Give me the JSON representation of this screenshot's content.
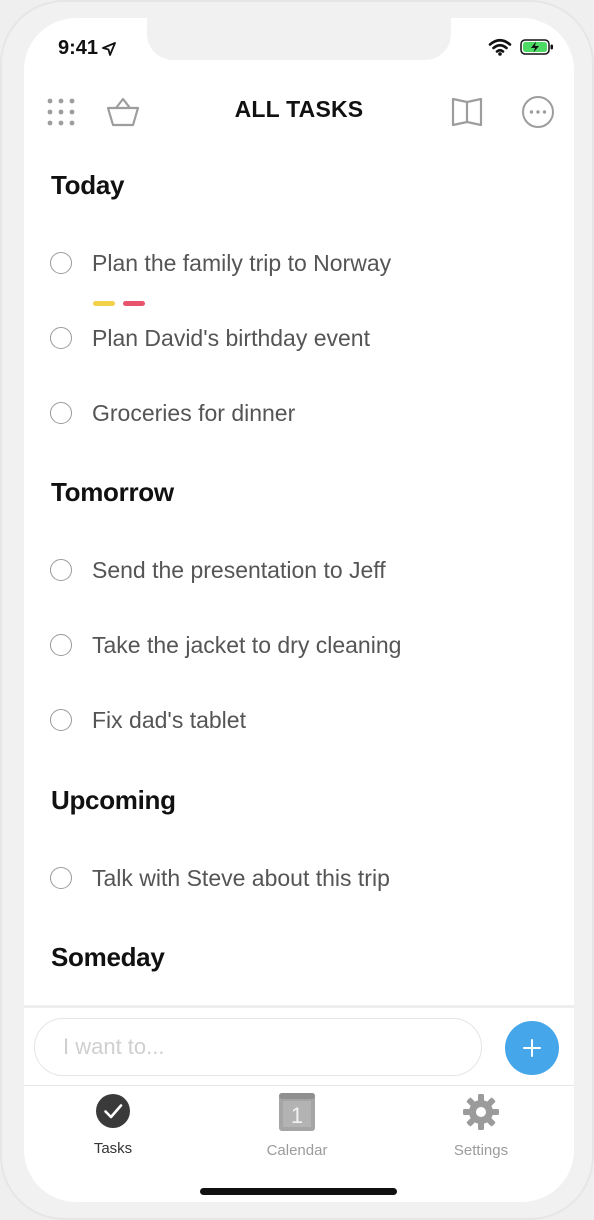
{
  "status": {
    "time": "9:41"
  },
  "header": {
    "title": "ALL TASKS"
  },
  "sections": [
    {
      "title": "Today"
    },
    {
      "title": "Tomorrow"
    },
    {
      "title": "Upcoming"
    },
    {
      "title": "Someday"
    }
  ],
  "tasks": [
    {
      "label": "Plan the family trip to Norway",
      "section": "Today",
      "tags": [
        "#f2d14b",
        "#e8546b"
      ]
    },
    {
      "label": "Plan David's birthday event",
      "section": "Today"
    },
    {
      "label": "Groceries for dinner",
      "section": "Today"
    },
    {
      "label": "Send the presentation to Jeff",
      "section": "Tomorrow"
    },
    {
      "label": "Take the jacket to dry cleaning",
      "section": "Tomorrow"
    },
    {
      "label": "Fix dad's tablet",
      "section": "Tomorrow"
    },
    {
      "label": "Talk with Steve about this trip",
      "section": "Upcoming"
    }
  ],
  "composer": {
    "placeholder": "I want to..."
  },
  "tabs": [
    {
      "label": "Tasks",
      "icon": "check-circle-icon",
      "active": true
    },
    {
      "label": "Calendar",
      "icon": "calendar-icon",
      "badge": "1"
    },
    {
      "label": "Settings",
      "icon": "gear-icon"
    }
  ],
  "colors": {
    "accent": "#46a6ea",
    "tag_yellow": "#f2d14b",
    "tag_red": "#e8546b",
    "active_tab": "#333333",
    "inactive_tab": "#9b9b9b"
  }
}
